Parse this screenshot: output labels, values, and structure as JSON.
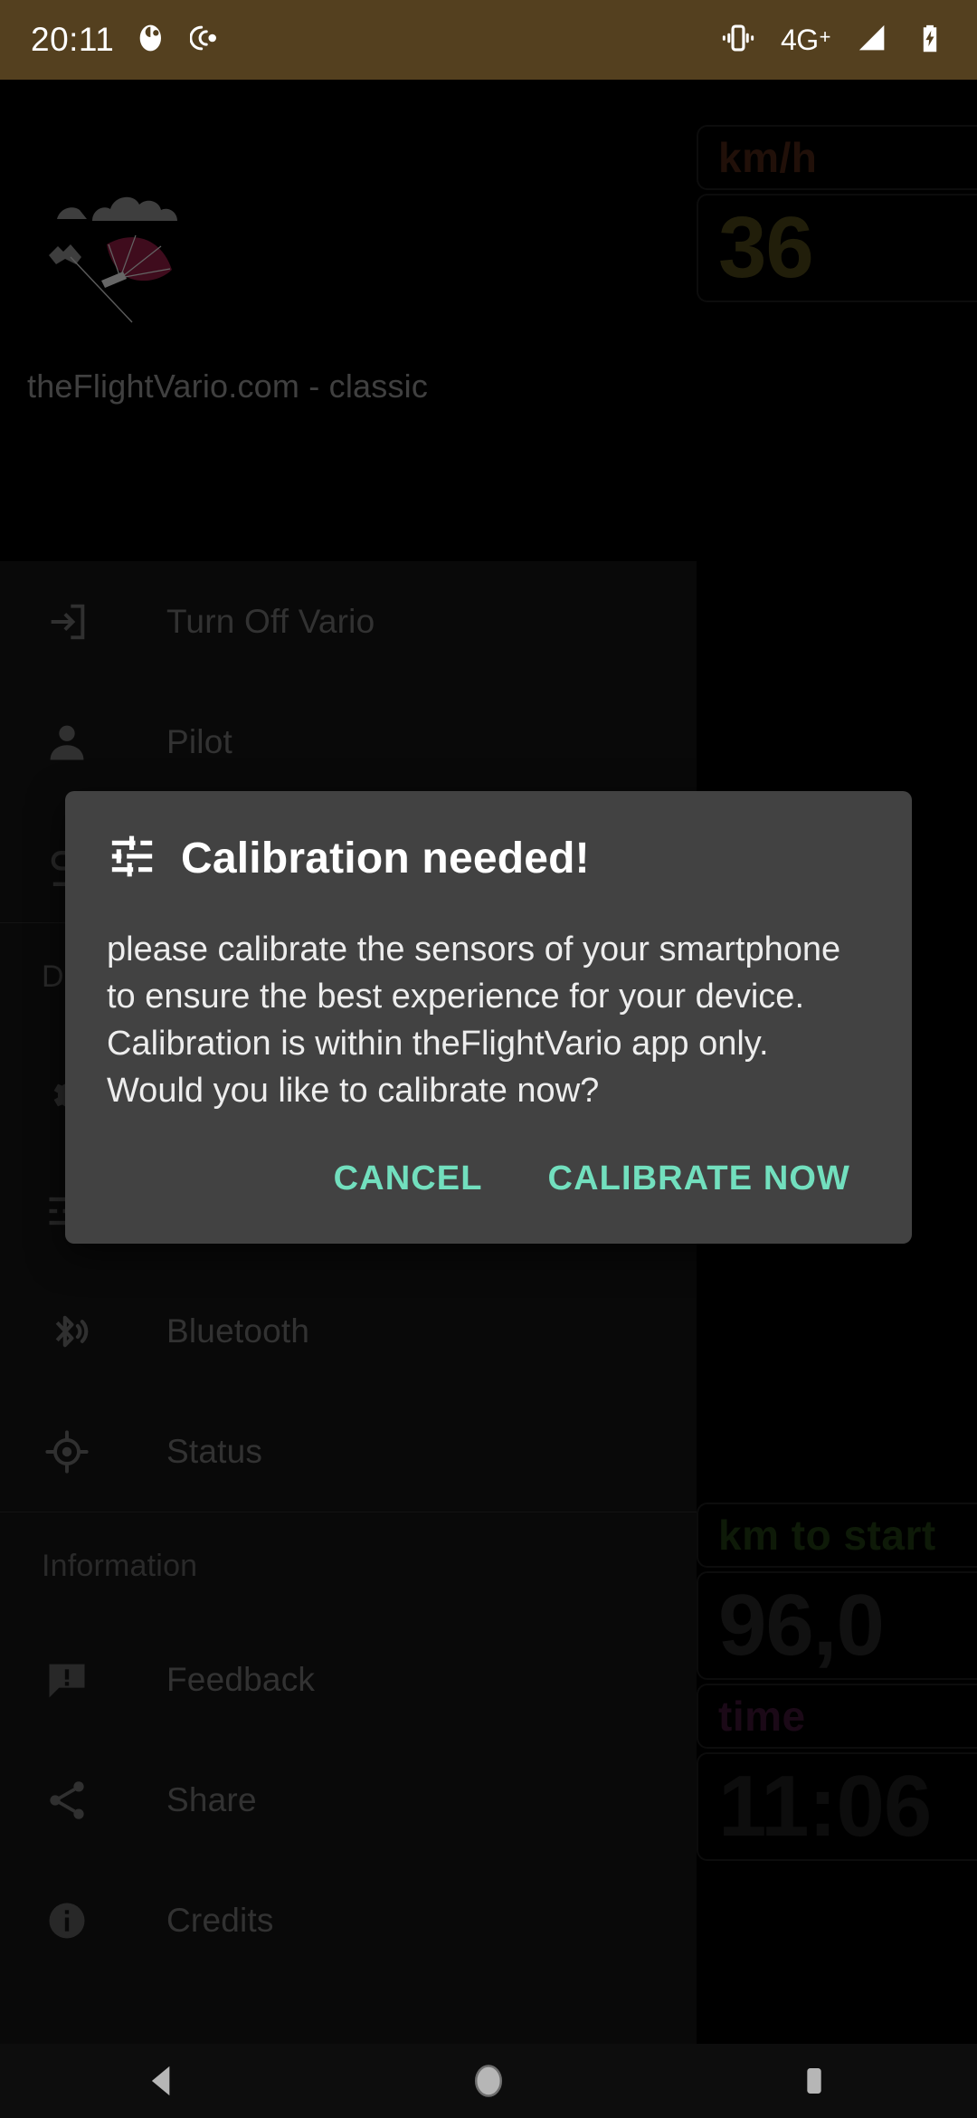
{
  "status_bar": {
    "clock": "20:11",
    "background_color": "#54401f",
    "left_icons": [
      "notification-dot-icon",
      "hearing-aid-icon"
    ],
    "network_label": "4G",
    "network_superscript": "+",
    "right_icons": [
      "vibrate-icon",
      "signal-strength-icon",
      "battery-charging-icon"
    ]
  },
  "app": {
    "brand_caption": "theFlightVario.com - classic",
    "logo_name": "paraglider-logo",
    "gauges_top": [
      {
        "label": "km/h",
        "label_color": "#4a2416",
        "value": "36",
        "value_color": "#4a4418"
      }
    ],
    "gauges_bottom": [
      {
        "label": "km to start",
        "label_color": "#1f3a12",
        "value": "96,0",
        "value_color": "#262626"
      },
      {
        "label": "time",
        "label_color": "#3d1633",
        "value": "11:06",
        "value_color": "#1e1e1e"
      }
    ]
  },
  "drawer": {
    "items": [
      {
        "label": "Turn Off Vario",
        "icon": "exit-to-app-icon"
      },
      {
        "label": "Pilot",
        "icon": "person-icon"
      },
      {
        "label": "Bluetooth",
        "icon": "bluetooth-searching-icon"
      },
      {
        "label": "Status",
        "icon": "gps-fixed-icon"
      },
      {
        "label": "Feedback",
        "icon": "feedback-icon"
      },
      {
        "label": "Share",
        "icon": "share-icon"
      },
      {
        "label": "Credits",
        "icon": "info-icon"
      }
    ],
    "section_information": "Information",
    "section_device": "D"
  },
  "dialog": {
    "title": "Calibration needed!",
    "title_icon": "tune-icon",
    "body": "please calibrate the sensors of your smartphone to ensure the best experience for your device. Calibration is within theFlightVario app only.  Would you like to calibrate now?",
    "cancel_label": "CANCEL",
    "confirm_label": "CALIBRATE NOW",
    "accent_color": "#72dfbe",
    "background_color": "#424242"
  },
  "navbar": {
    "back_label": "back-button",
    "home_label": "home-button",
    "recents_label": "recents-button"
  }
}
